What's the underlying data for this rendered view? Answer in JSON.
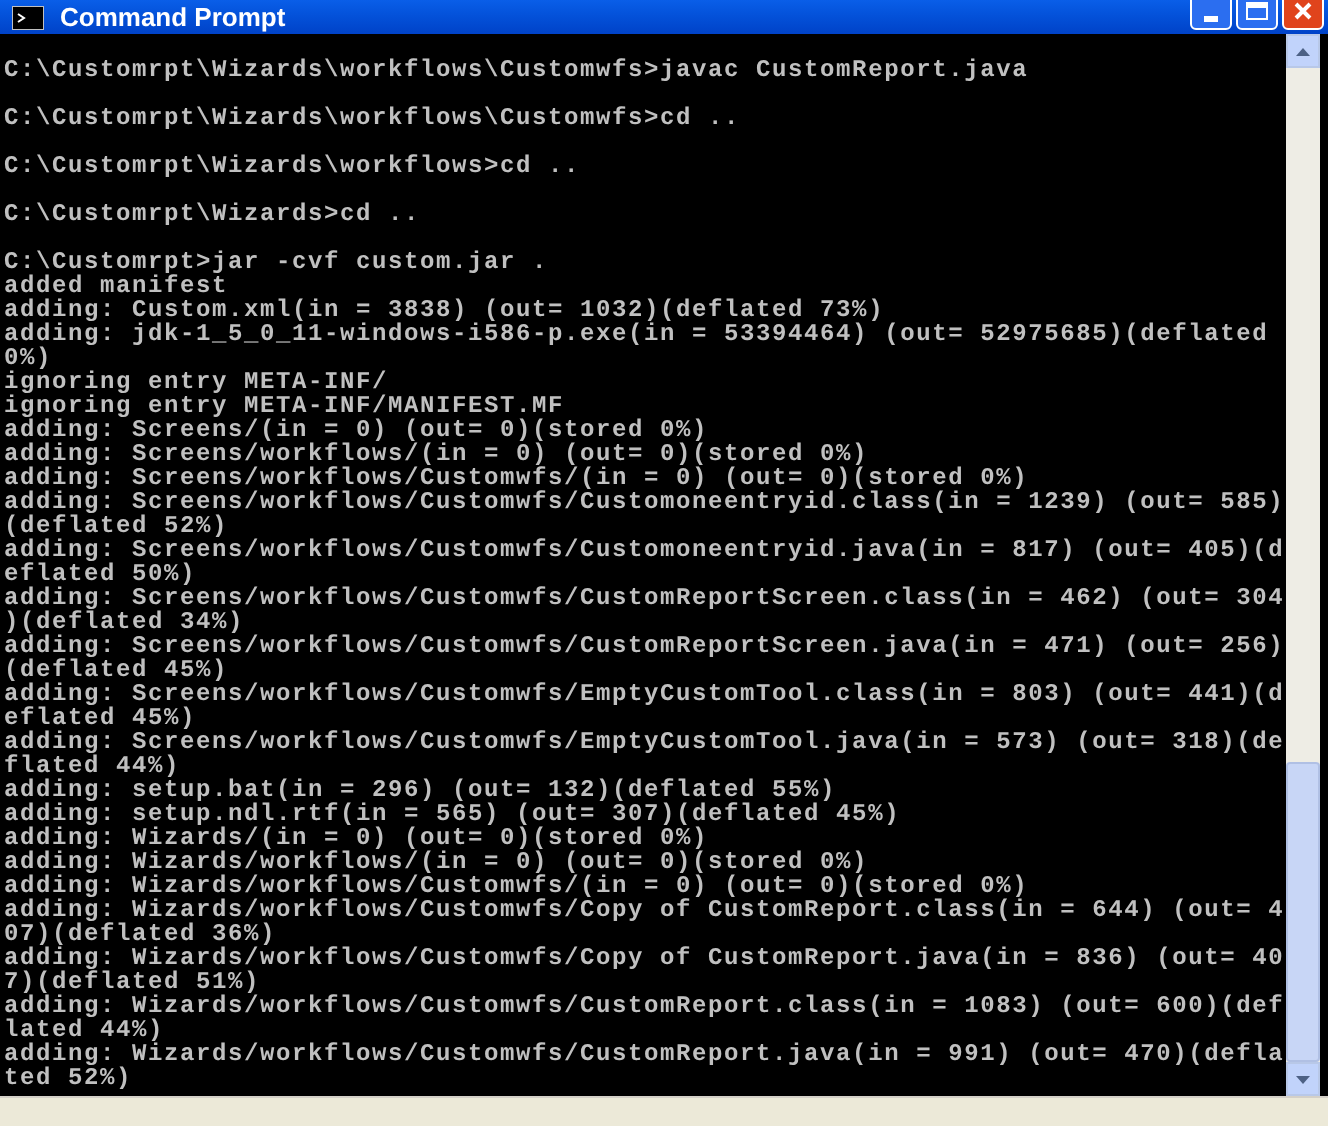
{
  "window": {
    "title": "Command Prompt"
  },
  "console": {
    "blocks": [
      {
        "command": "C:\\Customrpt\\Wizards\\workflows\\Customwfs>javac CustomReport.java"
      },
      {
        "command": "C:\\Customrpt\\Wizards\\workflows\\Customwfs>cd .."
      },
      {
        "command": "C:\\Customrpt\\Wizards\\workflows>cd .."
      },
      {
        "command": "C:\\Customrpt\\Wizards>cd .."
      },
      {
        "command": "C:\\Customrpt>jar -cvf custom.jar .",
        "output": [
          "added manifest",
          "adding: Custom.xml(in = 3838) (out= 1032)(deflated 73%)",
          "adding: jdk-1_5_0_11-windows-i586-p.exe(in = 53394464) (out= 52975685)(deflated",
          "0%)",
          "ignoring entry META-INF/",
          "ignoring entry META-INF/MANIFEST.MF",
          "adding: Screens/(in = 0) (out= 0)(stored 0%)",
          "adding: Screens/workflows/(in = 0) (out= 0)(stored 0%)",
          "adding: Screens/workflows/Customwfs/(in = 0) (out= 0)(stored 0%)",
          "adding: Screens/workflows/Customwfs/Customoneentryid.class(in = 1239) (out= 585)",
          "(deflated 52%)",
          "adding: Screens/workflows/Customwfs/Customoneentryid.java(in = 817) (out= 405)(d",
          "eflated 50%)",
          "adding: Screens/workflows/Customwfs/CustomReportScreen.class(in = 462) (out= 304",
          ")(deflated 34%)",
          "adding: Screens/workflows/Customwfs/CustomReportScreen.java(in = 471) (out= 256)",
          "(deflated 45%)",
          "adding: Screens/workflows/Customwfs/EmptyCustomTool.class(in = 803) (out= 441)(d",
          "eflated 45%)",
          "adding: Screens/workflows/Customwfs/EmptyCustomTool.java(in = 573) (out= 318)(de",
          "flated 44%)",
          "adding: setup.bat(in = 296) (out= 132)(deflated 55%)",
          "adding: setup.ndl.rtf(in = 565) (out= 307)(deflated 45%)",
          "adding: Wizards/(in = 0) (out= 0)(stored 0%)",
          "adding: Wizards/workflows/(in = 0) (out= 0)(stored 0%)",
          "adding: Wizards/workflows/Customwfs/(in = 0) (out= 0)(stored 0%)",
          "adding: Wizards/workflows/Customwfs/Copy of CustomReport.class(in = 644) (out= 4",
          "07)(deflated 36%)",
          "adding: Wizards/workflows/Customwfs/Copy of CustomReport.java(in = 836) (out= 40",
          "7)(deflated 51%)",
          "adding: Wizards/workflows/Customwfs/CustomReport.class(in = 1083) (out= 600)(def",
          "lated 44%)",
          "adding: Wizards/workflows/Customwfs/CustomReport.java(in = 991) (out= 470)(defla",
          "ted 52%)"
        ]
      }
    ]
  }
}
